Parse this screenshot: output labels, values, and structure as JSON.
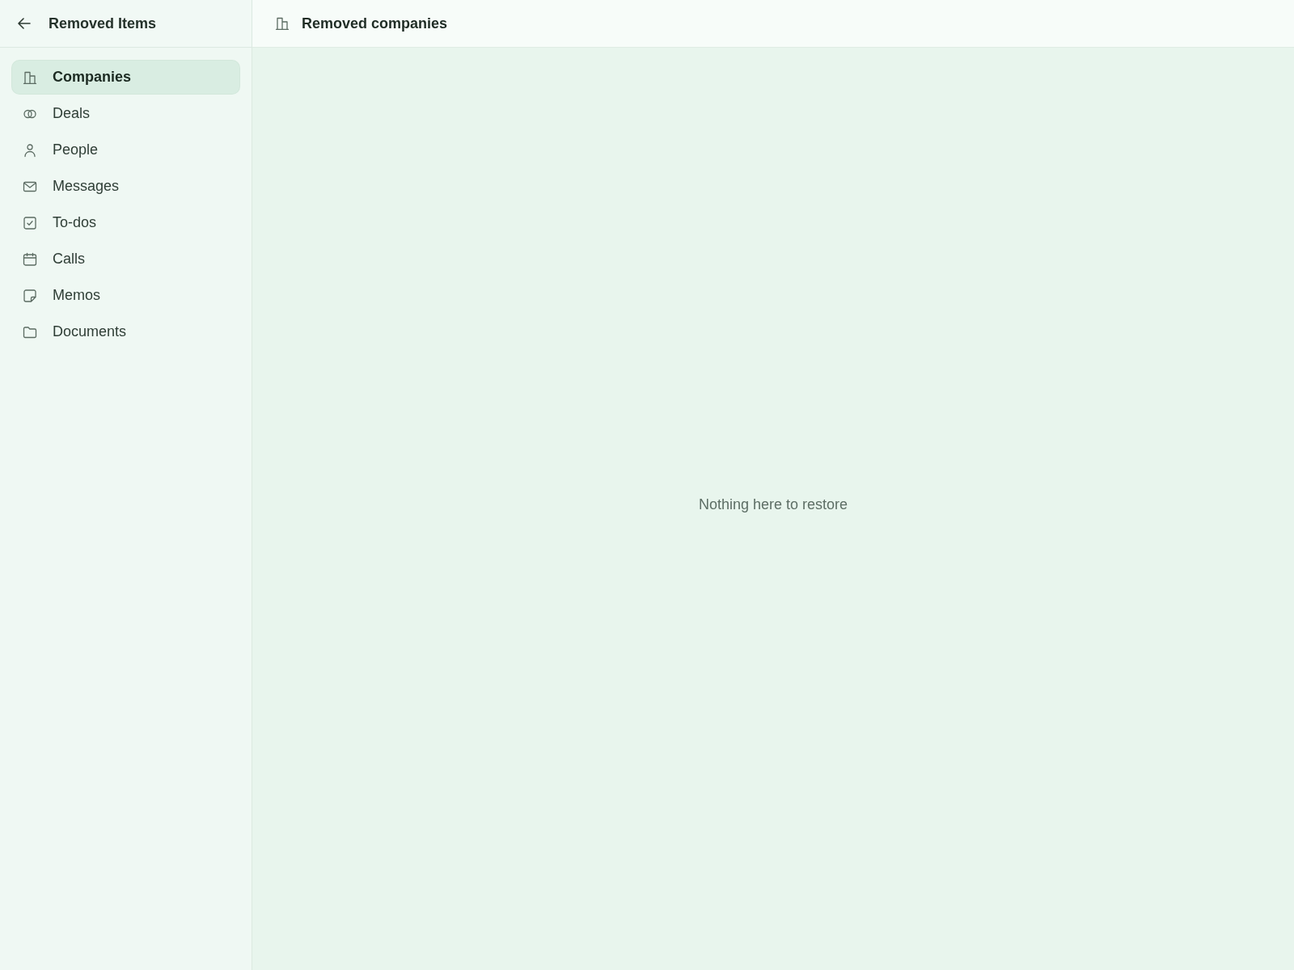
{
  "sidebar": {
    "title": "Removed Items",
    "items": [
      {
        "label": "Companies",
        "selected": true
      },
      {
        "label": "Deals",
        "selected": false
      },
      {
        "label": "People",
        "selected": false
      },
      {
        "label": "Messages",
        "selected": false
      },
      {
        "label": "To-dos",
        "selected": false
      },
      {
        "label": "Calls",
        "selected": false
      },
      {
        "label": "Memos",
        "selected": false
      },
      {
        "label": "Documents",
        "selected": false
      }
    ]
  },
  "main": {
    "title": "Removed companies",
    "empty_message": "Nothing here to restore"
  }
}
